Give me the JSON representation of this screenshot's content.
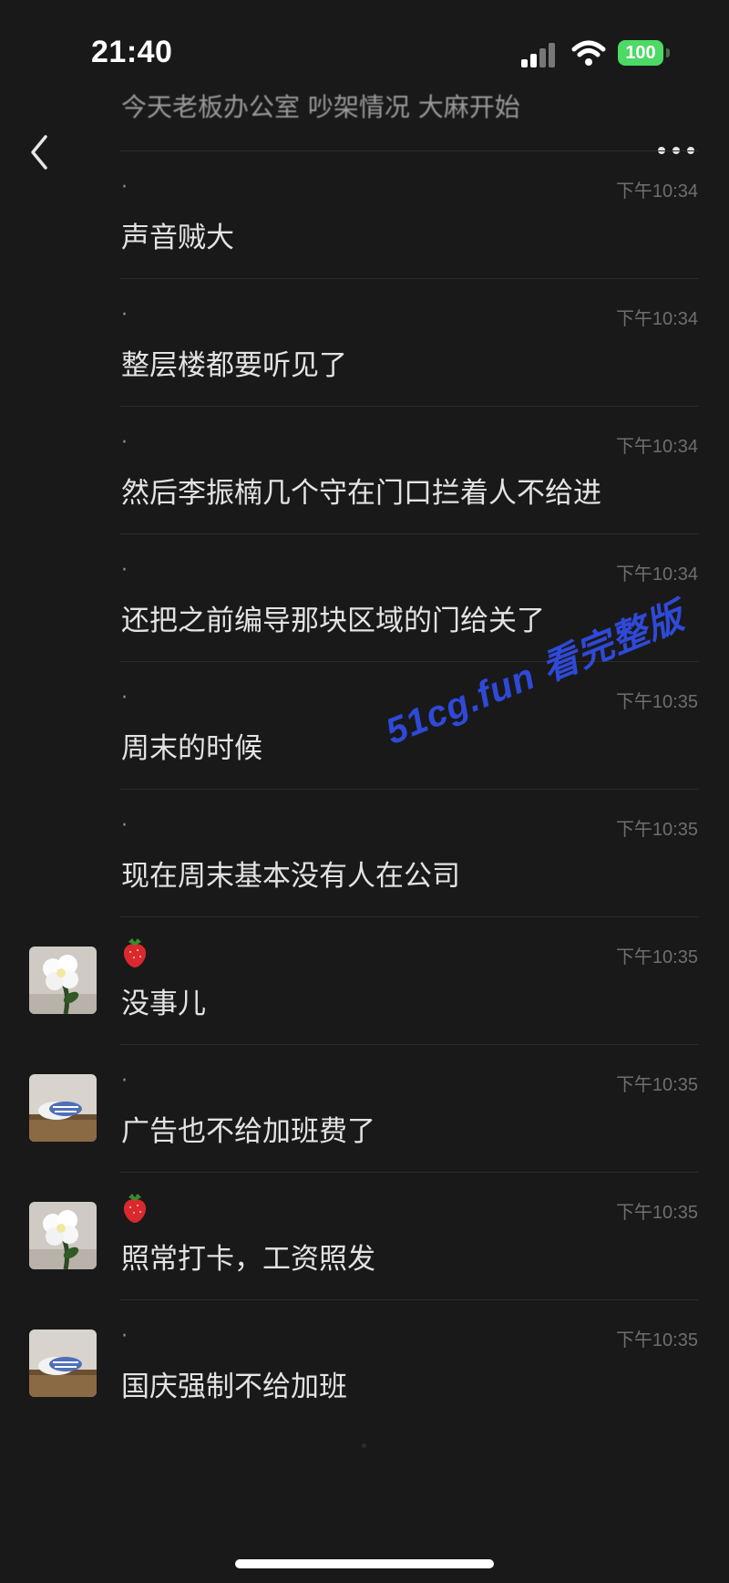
{
  "status_bar": {
    "time": "21:40",
    "battery": "100",
    "colors": {
      "battery": "#4cd964",
      "icons": "#ffffff"
    }
  },
  "nav": {
    "back_icon": "chevron-left-icon",
    "more_icon": "ellipsis-icon"
  },
  "partial_top_message": "今天老板办公室 吵架情况 大麻开始",
  "messages": [
    {
      "avatar": null,
      "sender": "·",
      "time": "下午10:34",
      "text": "声音贼大"
    },
    {
      "avatar": null,
      "sender": "·",
      "time": "下午10:34",
      "text": "整层楼都要听见了"
    },
    {
      "avatar": null,
      "sender": "·",
      "time": "下午10:34",
      "text": "然后李振楠几个守在门口拦着人不给进"
    },
    {
      "avatar": null,
      "sender": "·",
      "time": "下午10:34",
      "text": "还把之前编导那块区域的门给关了"
    },
    {
      "avatar": null,
      "sender": "·",
      "time": "下午10:35",
      "text": "周末的时候"
    },
    {
      "avatar": null,
      "sender": "·",
      "time": "下午10:35",
      "text": "现在周末基本没有人在公司"
    },
    {
      "avatar": "flower",
      "sender": "strawberry",
      "time": "下午10:35",
      "text": "没事儿"
    },
    {
      "avatar": "pillow",
      "sender": "·",
      "time": "下午10:35",
      "text": "广告也不给加班费了"
    },
    {
      "avatar": "flower",
      "sender": "strawberry",
      "time": "下午10:35",
      "text": "照常打卡，工资照发"
    },
    {
      "avatar": "pillow",
      "sender": "·",
      "time": "下午10:35",
      "text": "国庆强制不给加班"
    }
  ],
  "watermark": "51cg.fun 看完整版",
  "colors": {
    "background": "#191919",
    "watermark": "#2f49d8"
  }
}
